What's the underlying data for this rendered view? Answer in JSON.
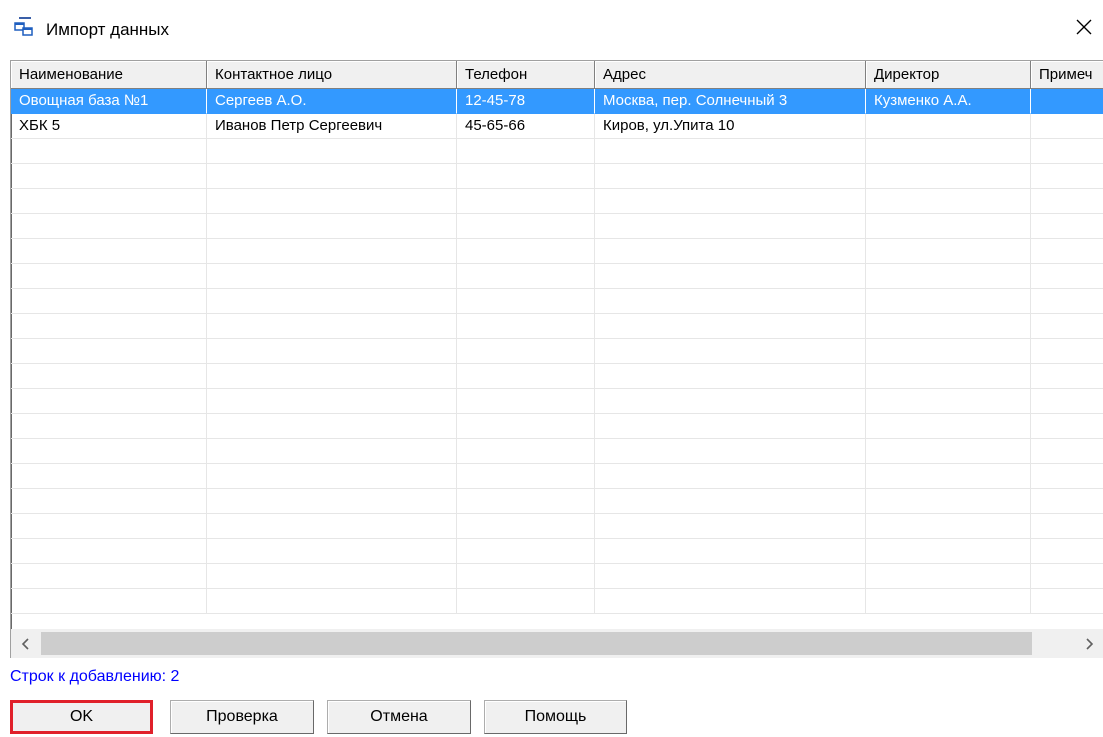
{
  "window": {
    "title": "Импорт данных",
    "icon": "table-import-icon",
    "close_icon": "close-icon"
  },
  "grid": {
    "columns": [
      "Наименование",
      "Контактное лицо",
      "Телефон",
      "Адрес",
      "Директор",
      "Примеч"
    ],
    "rows": [
      [
        "Овощная база №1",
        "Сергеев А.О.",
        "12-45-78",
        "Москва, пер. Солнечный 3",
        "Кузменко А.А.",
        ""
      ],
      [
        "ХБК 5",
        "Иванов Петр Сергеевич",
        "45-65-66",
        "Киров, ул.Упита 10",
        "",
        ""
      ]
    ],
    "selected_row": 0,
    "empty_rows": 19
  },
  "status": {
    "text": "Строк к добавлению: 2",
    "color": "#0000ff"
  },
  "buttons": {
    "ok": "OK",
    "check": "Проверка",
    "cancel": "Отмена",
    "help": "Помощь"
  },
  "colors": {
    "selection": "#3399ff",
    "focus_border": "#e0202a"
  }
}
